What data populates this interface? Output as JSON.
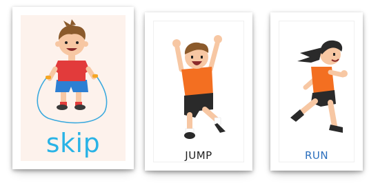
{
  "cards": {
    "skip": {
      "word": "skip",
      "color": "#29b3e6"
    },
    "jump": {
      "word": "JUMP",
      "color": "#1f1f1f"
    },
    "run": {
      "word": "RUN",
      "color": "#2b6fbd"
    }
  },
  "colors": {
    "shirt": "#f36f21",
    "skin": "#f7c7a3",
    "hair_brown": "#8b5a2b",
    "hair_black": "#2a2a2a",
    "shorts_blue": "#2d7fd3",
    "shorts_black": "#2a2a2a"
  }
}
